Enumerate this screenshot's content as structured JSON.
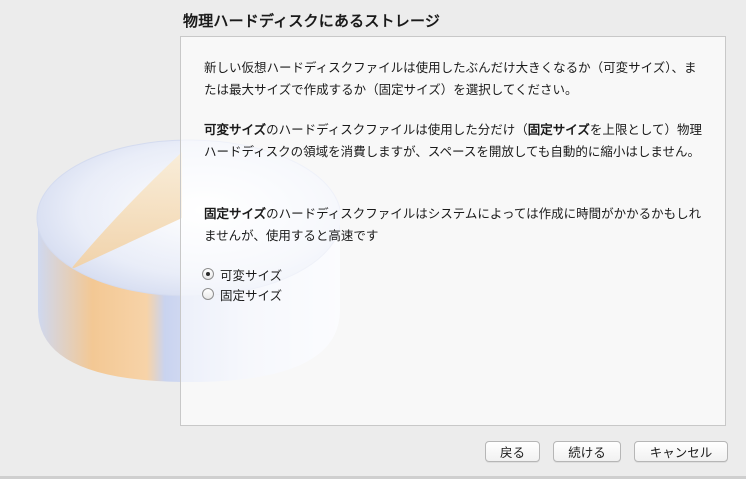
{
  "header": {
    "title": "物理ハードディスクにあるストレージ"
  },
  "content": {
    "paragraph1": "新しい仮想ハードディスクファイルは使用したぶんだけ大きくなるか（可変サイズ）、または最大サイズで作成するか（固定サイズ）を選択してください。",
    "paragraph2": {
      "term_dynamic": "可変サイズ",
      "part1": "のハードディスクファイルは使用した分だけ（",
      "term_fixed": "固定サイズ",
      "part2": "を上限として）物理ハードディスクの領域を消費しますが、スペースを開放しても自動的に縮小はしません。"
    },
    "paragraph3": {
      "term_fixed": "固定サイズ",
      "text": "のハードディスクファイルはシステムによっては作成に時間がかかるかもしれませんが、使用すると高速です"
    },
    "options": [
      {
        "label": "可変サイズ",
        "selected": true
      },
      {
        "label": "固定サイズ",
        "selected": false
      }
    ]
  },
  "buttons": {
    "back": "戻る",
    "continue": "続ける",
    "cancel": "キャンセル"
  }
}
